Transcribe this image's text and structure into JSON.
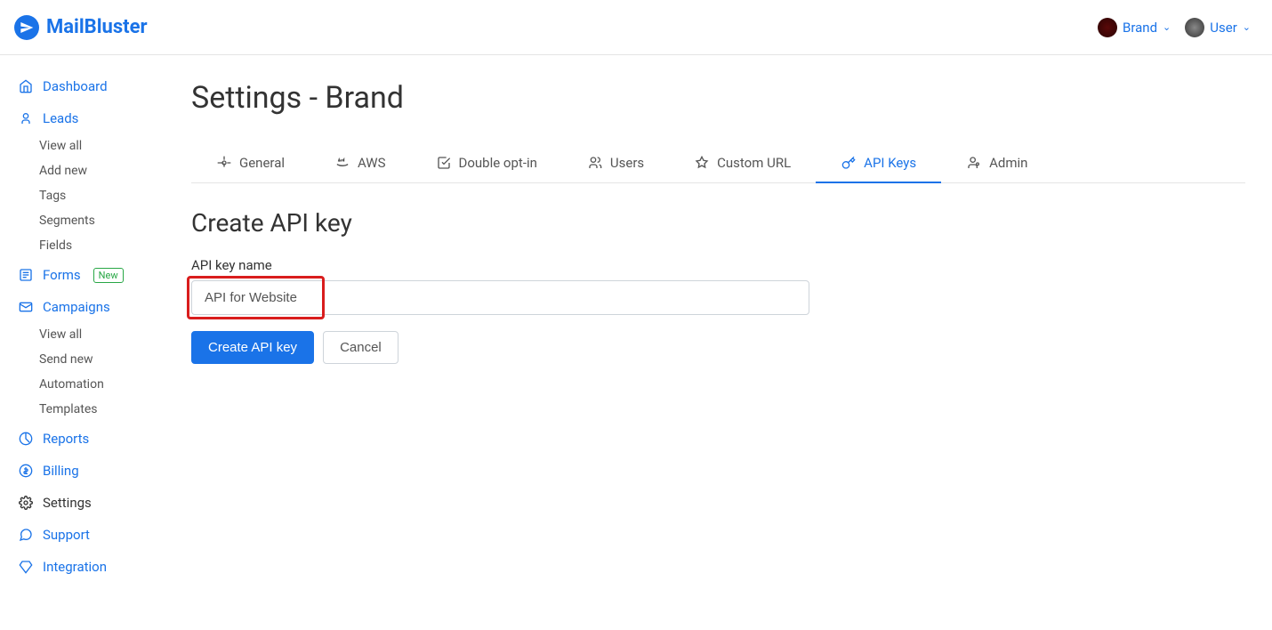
{
  "header": {
    "logo_text": "MailBluster",
    "brand_label": "Brand",
    "user_label": "User"
  },
  "sidebar": {
    "dashboard": "Dashboard",
    "leads": {
      "label": "Leads",
      "items": [
        "View all",
        "Add new",
        "Tags",
        "Segments",
        "Fields"
      ]
    },
    "forms": {
      "label": "Forms",
      "badge": "New"
    },
    "campaigns": {
      "label": "Campaigns",
      "items": [
        "View all",
        "Send new",
        "Automation",
        "Templates"
      ]
    },
    "reports": "Reports",
    "billing": "Billing",
    "settings": "Settings",
    "support": "Support",
    "integration": "Integration"
  },
  "page": {
    "title": "Settings - Brand",
    "tabs": {
      "general": "General",
      "aws": "AWS",
      "double_opt_in": "Double opt-in",
      "users": "Users",
      "custom_url": "Custom URL",
      "api_keys": "API Keys",
      "admin": "Admin"
    },
    "section_title": "Create API key",
    "form": {
      "label": "API key name",
      "value": "API for Website",
      "submit": "Create API key",
      "cancel": "Cancel"
    }
  }
}
